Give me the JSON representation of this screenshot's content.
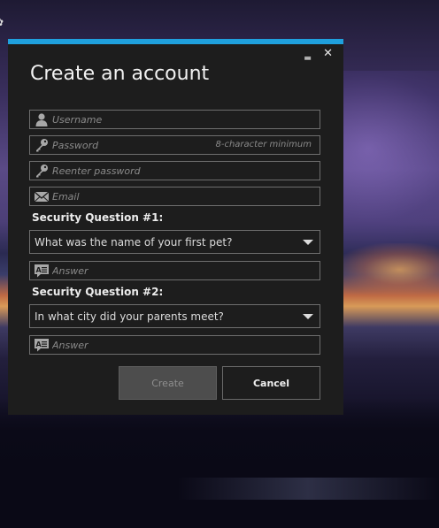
{
  "window": {
    "title": "Create an account",
    "minimize_glyph": "‗",
    "close_glyph": "✕",
    "accent_color": "#1fa0dd"
  },
  "form": {
    "username": {
      "placeholder": "Username",
      "icon": "user-icon"
    },
    "password": {
      "placeholder": "Password",
      "hint": "8-character minimum",
      "icon": "key-icon"
    },
    "reenter_password": {
      "placeholder": "Reenter password",
      "icon": "key-icon"
    },
    "email": {
      "placeholder": "Email",
      "icon": "envelope-icon"
    },
    "security_q1": {
      "label": "Security Question #1:",
      "selected": "What was the name of your first pet?",
      "answer_placeholder": "Answer",
      "answer_icon": "answer-icon"
    },
    "security_q2": {
      "label": "Security Question #2:",
      "selected": "In what city did your parents meet?",
      "answer_placeholder": "Answer",
      "answer_icon": "answer-icon"
    }
  },
  "buttons": {
    "create": "Create",
    "cancel": "Cancel"
  }
}
